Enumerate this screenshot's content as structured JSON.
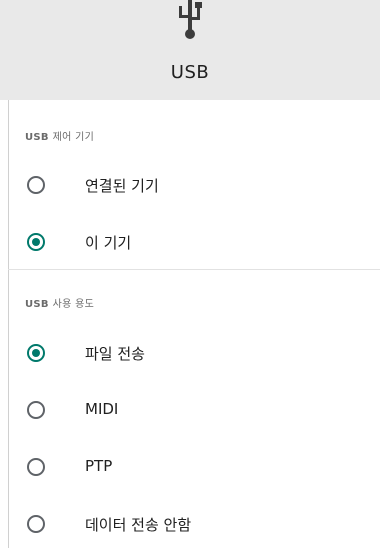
{
  "header": {
    "icon": "usb-icon",
    "title": "USB"
  },
  "sections": [
    {
      "label_bold": "USB",
      "label_rest": "제어 기기",
      "options": [
        {
          "label": "연결된 기기",
          "selected": false
        },
        {
          "label": "이 기기",
          "selected": true
        }
      ]
    },
    {
      "label_bold": "USB",
      "label_rest": "사용 용도",
      "options": [
        {
          "label": "파일 전송",
          "selected": true
        },
        {
          "label": "MIDI",
          "selected": false
        },
        {
          "label": "PTP",
          "selected": false
        },
        {
          "label": "데이터 전송 안함",
          "selected": false
        }
      ]
    }
  ],
  "colors": {
    "accent": "#00796b",
    "header_bg": "#e9e9e9",
    "unchecked": "#5f6368"
  }
}
